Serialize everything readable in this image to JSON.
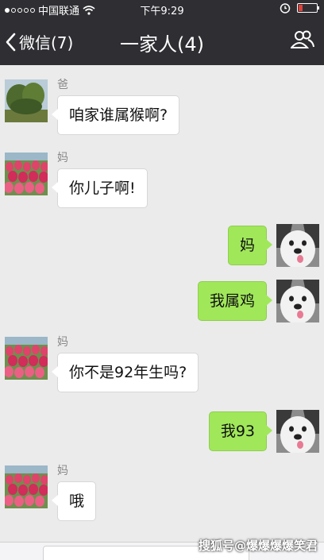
{
  "status_bar": {
    "carrier": "中国联通",
    "time": "下午9:29"
  },
  "nav": {
    "back_label": "微信(7)",
    "title": "一家人(4)"
  },
  "messages": [
    {
      "sender": "爸",
      "text": "咱家谁属猴啊?",
      "direction": "in"
    },
    {
      "sender": "妈",
      "text": "你儿子啊!",
      "direction": "in"
    },
    {
      "text": "妈",
      "direction": "out"
    },
    {
      "text": "我属鸡",
      "direction": "out"
    },
    {
      "sender": "妈",
      "text": "你不是92年生吗?",
      "direction": "in"
    },
    {
      "text": "我93",
      "direction": "out"
    },
    {
      "sender": "妈",
      "text": "哦",
      "direction": "in"
    }
  ],
  "watermark": "搜狐号@爆爆爆爆笑君"
}
